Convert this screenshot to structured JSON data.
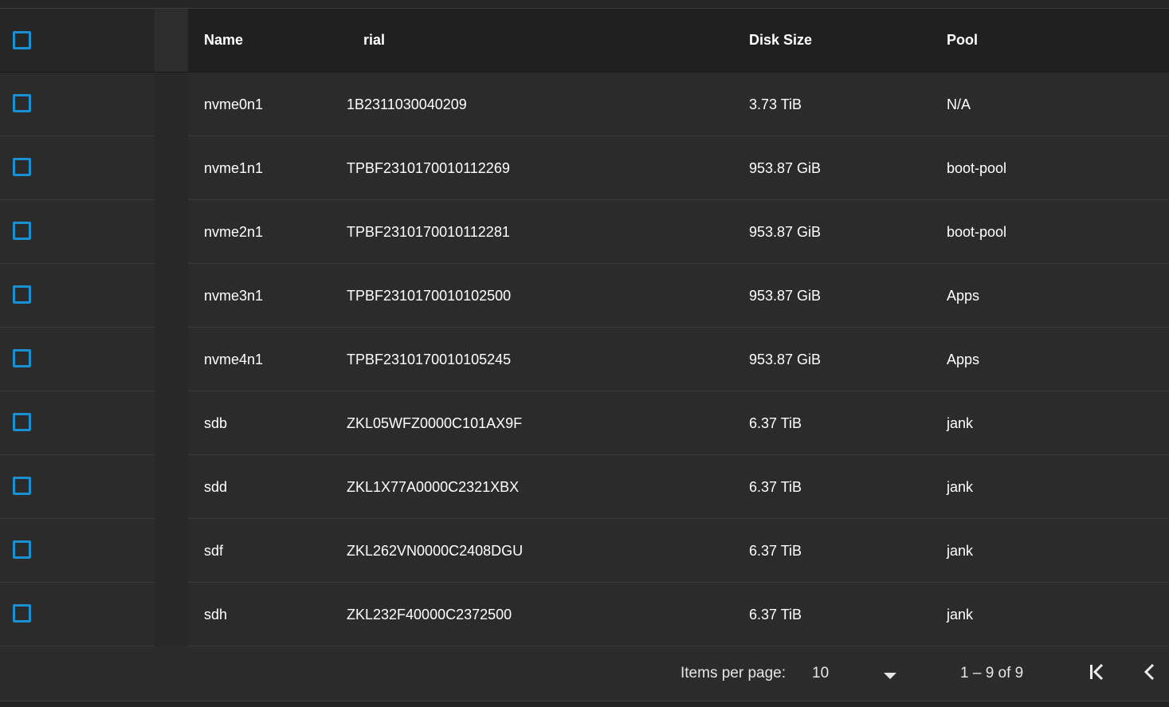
{
  "table": {
    "headers": {
      "name": "Name",
      "serial": "rial",
      "disk_size": "Disk Size",
      "pool": "Pool"
    },
    "rows": [
      {
        "name": "nvme0n1",
        "serial": "1B2311030040209",
        "disk_size": "3.73 TiB",
        "pool": "N/A"
      },
      {
        "name": "nvme1n1",
        "serial": "TPBF2310170010112269",
        "disk_size": "953.87 GiB",
        "pool": "boot-pool"
      },
      {
        "name": "nvme2n1",
        "serial": "TPBF2310170010112281",
        "disk_size": "953.87 GiB",
        "pool": "boot-pool"
      },
      {
        "name": "nvme3n1",
        "serial": "TPBF2310170010102500",
        "disk_size": "953.87 GiB",
        "pool": "Apps"
      },
      {
        "name": "nvme4n1",
        "serial": "TPBF2310170010105245",
        "disk_size": "953.87 GiB",
        "pool": "Apps"
      },
      {
        "name": "sdb",
        "serial": "ZKL05WFZ0000C101AX9F",
        "disk_size": "6.37 TiB",
        "pool": "jank"
      },
      {
        "name": "sdd",
        "serial": "ZKL1X77A0000C2321XBX",
        "disk_size": "6.37 TiB",
        "pool": "jank"
      },
      {
        "name": "sdf",
        "serial": "ZKL262VN0000C2408DGU",
        "disk_size": "6.37 TiB",
        "pool": "jank"
      },
      {
        "name": "sdh",
        "serial": "ZKL232F40000C2372500",
        "disk_size": "6.37 TiB",
        "pool": "jank"
      }
    ]
  },
  "paginator": {
    "items_per_page_label": "Items per page:",
    "page_size": "10",
    "range_label": "1 – 9 of 9"
  },
  "icons": {
    "dropdown": "caret-down-icon",
    "first_page": "first-page-icon",
    "previous_page": "chevron-left-icon"
  },
  "colors": {
    "checkbox_border": "#1a8fd1",
    "background": "#2b2b2b",
    "header_background": "#202020"
  }
}
